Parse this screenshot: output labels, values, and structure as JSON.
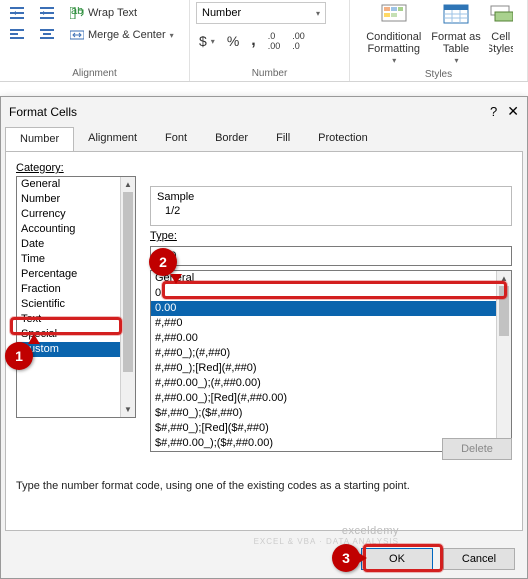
{
  "ribbon": {
    "wrap_text": "Wrap Text",
    "merge_center": "Merge & Center",
    "group_alignment": "Alignment",
    "numfmt_selected": "Number",
    "group_number": "Number",
    "cond_fmt": "Conditional\nFormatting",
    "fmt_table": "Format as\nTable",
    "cell_styles": "Cell\nStyles",
    "group_styles": "Styles"
  },
  "dialog": {
    "title": "Format Cells",
    "tabs": [
      "Number",
      "Alignment",
      "Font",
      "Border",
      "Fill",
      "Protection"
    ],
    "category_label": "Category:",
    "categories": [
      "General",
      "Number",
      "Currency",
      "Accounting",
      "Date",
      "Time",
      "Percentage",
      "Fraction",
      "Scientific",
      "Text",
      "Special",
      "Custom"
    ],
    "sample_label": "Sample",
    "sample_value": "1/2",
    "type_label": "Type:",
    "type_value": "0.00",
    "formats": [
      "General",
      "0",
      "0.00",
      "#,##0",
      "#,##0.00",
      "#,##0_);(#,##0)",
      "#,##0_);[Red](#,##0)",
      "#,##0.00_);(#,##0.00)",
      "#,##0.00_);[Red](#,##0.00)",
      "$#,##0_);($#,##0)",
      "$#,##0_);[Red]($#,##0)",
      "$#,##0.00_);($#,##0.00)"
    ],
    "delete": "Delete",
    "hint": "Type the number format code, using one of the existing codes as a starting point.",
    "ok": "OK",
    "cancel": "Cancel"
  },
  "annotations": {
    "step1": "1",
    "step2": "2",
    "step3": "3"
  },
  "watermark": {
    "brand": "exceldemy",
    "tag": "EXCEL & VBA · DATA ANALYSIS"
  }
}
